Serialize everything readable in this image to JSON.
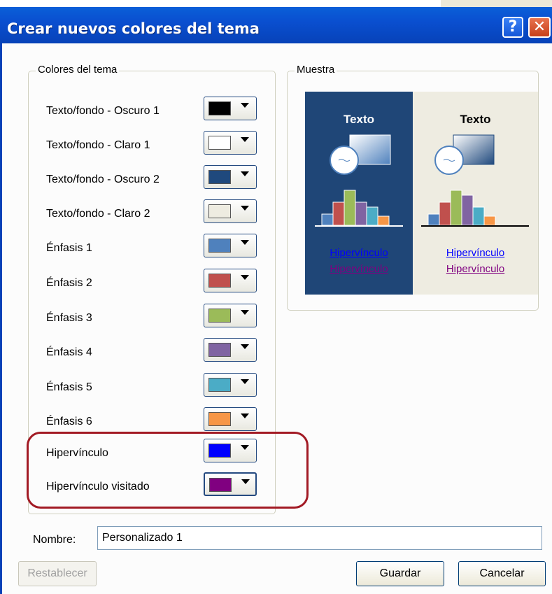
{
  "window": {
    "title": "Crear nuevos colores del tema",
    "help_glyph": "?",
    "close_glyph": "✕"
  },
  "theme_colors": {
    "legend": "Colores del tema",
    "rows": [
      {
        "label": "Texto/fondo - Oscuro 1",
        "color": "#000000"
      },
      {
        "label": "Texto/fondo - Claro 1",
        "color": "#ffffff"
      },
      {
        "label": "Texto/fondo - Oscuro 2",
        "color": "#1f497d"
      },
      {
        "label": "Texto/fondo - Claro 2",
        "color": "#eeece1"
      },
      {
        "label": "Énfasis 1",
        "color": "#4f81bd"
      },
      {
        "label": "Énfasis 2",
        "color": "#c0504d"
      },
      {
        "label": "Énfasis 3",
        "color": "#9bbb59"
      },
      {
        "label": "Énfasis 4",
        "color": "#8064a2"
      },
      {
        "label": "Énfasis 5",
        "color": "#4bacc6"
      },
      {
        "label": "Énfasis 6",
        "color": "#f79646"
      },
      {
        "label": "Hipervínculo",
        "color": "#0000ff"
      },
      {
        "label": "Hipervínculo visitado",
        "color": "#800080"
      }
    ]
  },
  "sample": {
    "legend": "Muestra",
    "dark": {
      "text": "Texto",
      "link": "Hipervínculo",
      "visited": "Hipervínculo"
    },
    "light": {
      "text": "Texto",
      "link": "Hipervínculo",
      "visited": "Hipervínculo"
    }
  },
  "name": {
    "label": "Nombre:",
    "value": "Personalizado 1"
  },
  "buttons": {
    "reset": "Restablecer",
    "save": "Guardar",
    "cancel": "Cancelar"
  }
}
